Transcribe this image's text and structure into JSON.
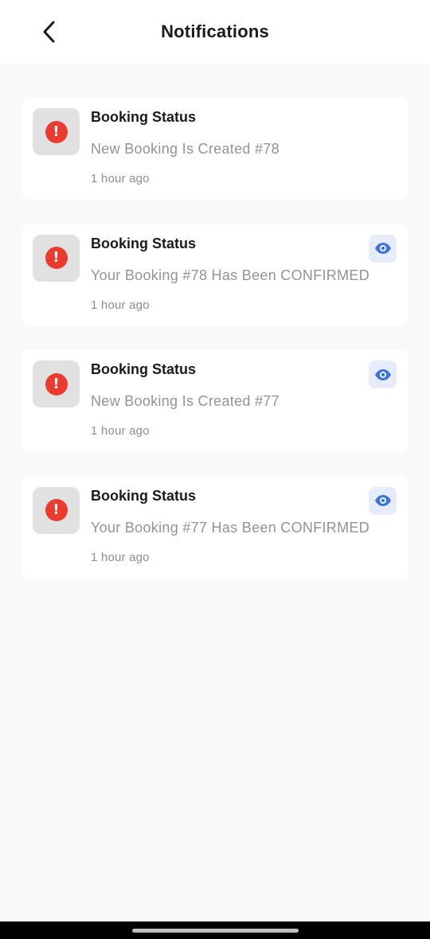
{
  "header": {
    "title": "Notifications",
    "back_icon": "chevron-left-icon"
  },
  "notifications": [
    {
      "title": "Booking Status",
      "message": "New Booking Is Created #78",
      "time": "1 hour ago",
      "icon": "alert-circle-icon",
      "has_view_button": false
    },
    {
      "title": "Booking Status",
      "message": "Your Booking #78 Has Been CONFIRMED",
      "time": "1 hour ago",
      "icon": "alert-circle-icon",
      "has_view_button": true
    },
    {
      "title": "Booking Status",
      "message": "New Booking Is Created #77",
      "time": "1 hour ago",
      "icon": "alert-circle-icon",
      "has_view_button": true
    },
    {
      "title": "Booking Status",
      "message": "Your Booking #77 Has Been CONFIRMED",
      "time": "1 hour ago",
      "icon": "alert-circle-icon",
      "has_view_button": true
    }
  ],
  "alert_icon_glyph": "!",
  "colors": {
    "alert": "#ea3b2e",
    "view_accent": "#3b74e0",
    "view_bg": "#e6ecfb",
    "background": "#f9f9f9"
  }
}
